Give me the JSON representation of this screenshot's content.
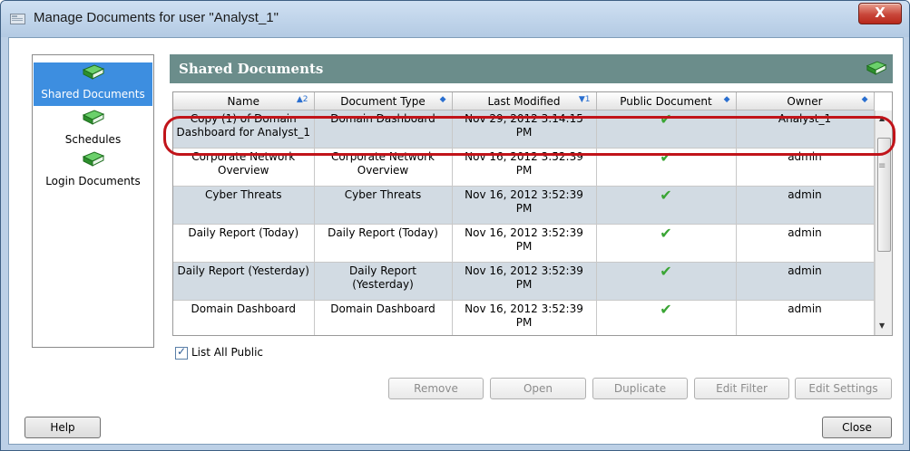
{
  "window": {
    "title": "Manage Documents for user \"Analyst_1\"",
    "close_label": "X"
  },
  "sidebar": {
    "items": [
      {
        "label": "Shared Documents",
        "selected": true,
        "icon": "green-book-icon"
      },
      {
        "label": "Schedules",
        "selected": false,
        "icon": "green-book-icon"
      },
      {
        "label": "Login Documents",
        "selected": false,
        "icon": "green-book-icon"
      }
    ]
  },
  "panel": {
    "title": "Shared Documents",
    "icon": "green-book-icon"
  },
  "table": {
    "columns": [
      {
        "label": "Name",
        "sort": "▲2"
      },
      {
        "label": "Document Type",
        "sort": "◆"
      },
      {
        "label": "Last Modified",
        "sort": "▼1"
      },
      {
        "label": "Public Document",
        "sort": "◆"
      },
      {
        "label": "Owner",
        "sort": "◆"
      }
    ],
    "rows": [
      {
        "name": "Copy (1) of Domain Dashboard for Analyst_1",
        "type": "Domain Dashboard",
        "modified": "Nov 29, 2012 3:14:15 PM",
        "public": "✔",
        "owner": "Analyst_1",
        "highlighted": true
      },
      {
        "name": "Corporate Network Overview",
        "type": "Corporate Network Overview",
        "modified": "Nov 16, 2012 3:52:39 PM",
        "public": "✔",
        "owner": "admin"
      },
      {
        "name": "Cyber Threats",
        "type": "Cyber Threats",
        "modified": "Nov 16, 2012 3:52:39 PM",
        "public": "✔",
        "owner": "admin"
      },
      {
        "name": "Daily Report (Today)",
        "type": "Daily Report (Today)",
        "modified": "Nov 16, 2012 3:52:39 PM",
        "public": "✔",
        "owner": "admin"
      },
      {
        "name": "Daily Report (Yesterday)",
        "type": "Daily Report (Yesterday)",
        "modified": "Nov 16, 2012 3:52:39 PM",
        "public": "✔",
        "owner": "admin"
      },
      {
        "name": "Domain Dashboard",
        "type": "Domain Dashboard",
        "modified": "Nov 16, 2012 3:52:39 PM",
        "public": "✔",
        "owner": "admin"
      }
    ]
  },
  "options": {
    "list_all_public_label": "List All Public",
    "list_all_public_checked": true
  },
  "buttons": {
    "remove": "Remove",
    "open": "Open",
    "duplicate": "Duplicate",
    "edit_filter": "Edit Filter",
    "edit_settings": "Edit Settings",
    "help": "Help",
    "close": "Close"
  },
  "colors": {
    "header_bar": "#6b8d8b",
    "selected_sidebar": "#3d8ee0",
    "alt_row": "#d2dbe3",
    "highlight_ring": "#c1141a",
    "check": "#3aa534"
  }
}
